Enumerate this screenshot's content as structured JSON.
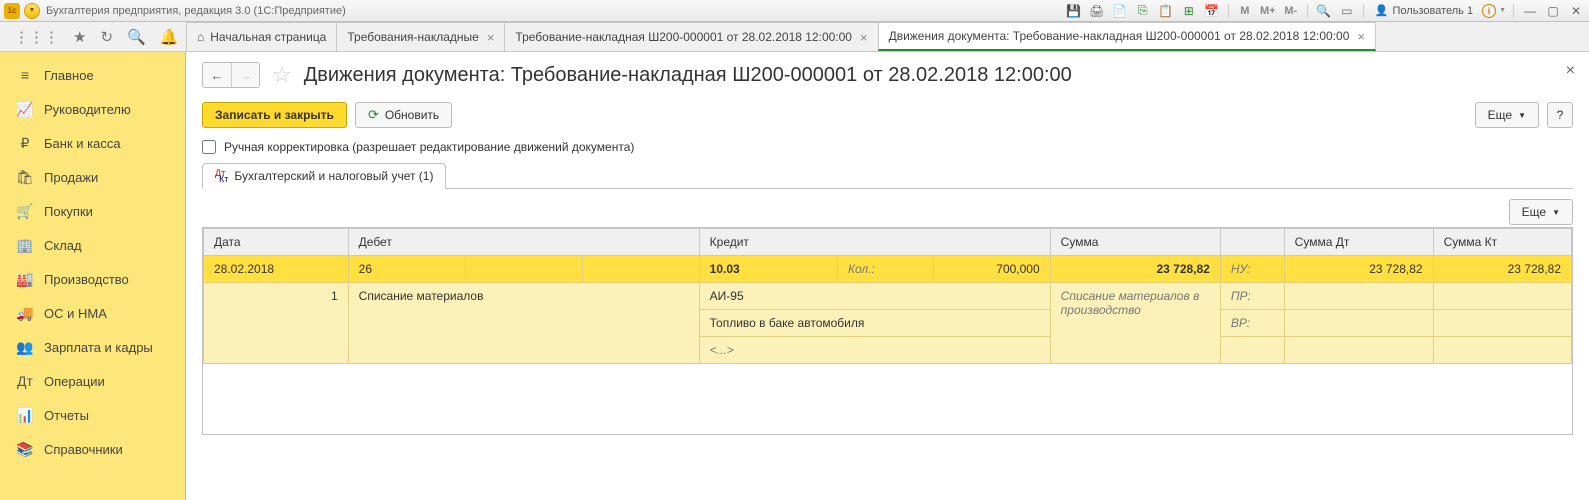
{
  "titlebar": {
    "app_title": "Бухгалтерия предприятия, редакция 3.0  (1С:Предприятие)",
    "user_label": "Пользователь 1",
    "m_labels": [
      "M",
      "M+",
      "M-"
    ]
  },
  "tabs": [
    {
      "label": "Начальная страница",
      "home": true
    },
    {
      "label": "Требования-накладные",
      "closable": true
    },
    {
      "label": "Требование-накладная Ш200-000001 от 28.02.2018 12:00:00",
      "closable": true
    },
    {
      "label": "Движения документа: Требование-накладная Ш200-000001 от 28.02.2018 12:00:00",
      "closable": true,
      "active": true
    }
  ],
  "sidebar": {
    "items": [
      {
        "icon": "≡",
        "label": "Главное"
      },
      {
        "icon": "📈",
        "label": "Руководителю"
      },
      {
        "icon": "₽",
        "label": "Банк и касса"
      },
      {
        "icon": "🛍",
        "label": "Продажи"
      },
      {
        "icon": "🛒",
        "label": "Покупки"
      },
      {
        "icon": "🏢",
        "label": "Склад"
      },
      {
        "icon": "🏭",
        "label": "Производство"
      },
      {
        "icon": "🚚",
        "label": "ОС и НМА"
      },
      {
        "icon": "👥",
        "label": "Зарплата и кадры"
      },
      {
        "icon": "Дт",
        "label": "Операции"
      },
      {
        "icon": "📊",
        "label": "Отчеты"
      },
      {
        "icon": "📚",
        "label": "Справочники"
      }
    ]
  },
  "page": {
    "title": "Движения документа: Требование-накладная Ш200-000001 от 28.02.2018 12:00:00",
    "save_close_label": "Записать и закрыть",
    "refresh_label": "Обновить",
    "more_label": "Еще",
    "help_label": "?",
    "manual_label": "Ручная корректировка (разрешает редактирование движений документа)",
    "sub_tab_label": "Бухгалтерский и налоговый учет (1)"
  },
  "grid": {
    "headers": {
      "date": "Дата",
      "debit": "Дебет",
      "credit": "Кредит",
      "sum": "Сумма",
      "sum_dt": "Сумма Дт",
      "sum_kt": "Сумма Кт"
    },
    "row1": {
      "date": "28.02.2018",
      "debit_acc": "26",
      "credit_acc": "10.03",
      "qty_label": "Кол.:",
      "qty": "700,000",
      "sum": "23 728,82",
      "tag": "НУ:",
      "sum_dt": "23 728,82",
      "sum_kt": "23 728,82"
    },
    "row2": {
      "n": "1",
      "debit_desc": "Списание материалов",
      "credit_desc": "АИ-95",
      "sum_desc": "Списание материалов в производство",
      "tag": "ПР:"
    },
    "row3": {
      "credit_desc": "Топливо в баке автомобиля",
      "tag": "ВР:"
    },
    "row4": {
      "credit_desc": "<...>"
    }
  }
}
